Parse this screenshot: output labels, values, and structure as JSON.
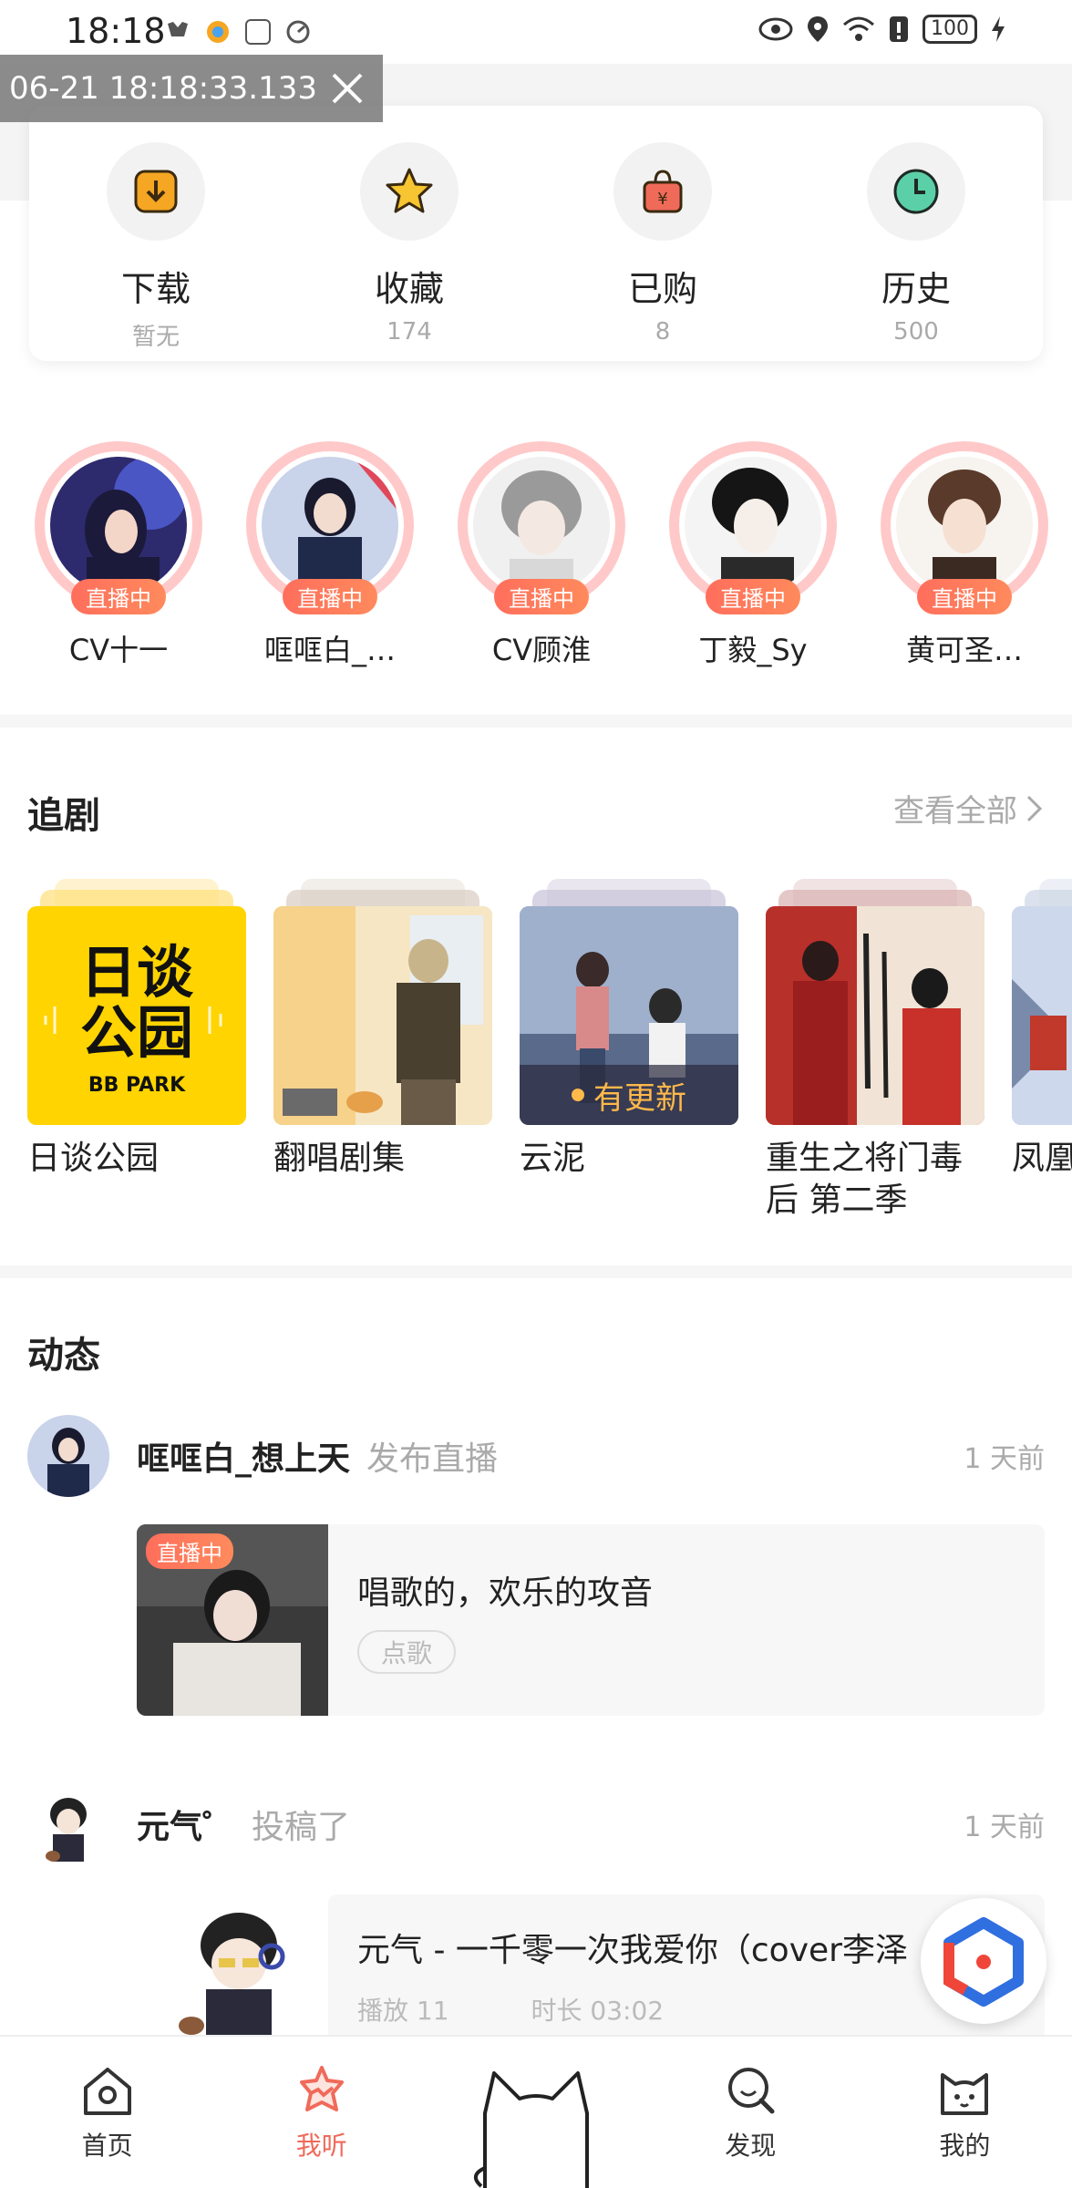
{
  "status_bar": {
    "time": "18:18",
    "battery": "100"
  },
  "toast": {
    "text": "06-21 18:18:33.133"
  },
  "quick_actions": [
    {
      "label": "下载",
      "sub": "暂无",
      "icon": "download-icon",
      "color": "#f5a623"
    },
    {
      "label": "收藏",
      "sub": "174",
      "icon": "star-icon",
      "color": "#f7c531"
    },
    {
      "label": "已购",
      "sub": "8",
      "icon": "shopping-bag-icon",
      "color": "#f06a5a"
    },
    {
      "label": "历史",
      "sub": "500",
      "icon": "clock-icon",
      "color": "#5bd0a8"
    }
  ],
  "live_users": [
    {
      "name": "CV十一",
      "badge": "直播中"
    },
    {
      "name": "哐哐白_…",
      "badge": "直播中"
    },
    {
      "name": "CV顾淮",
      "badge": "直播中"
    },
    {
      "name": "丁毅_Sy",
      "badge": "直播中"
    },
    {
      "name": "黄可圣…",
      "badge": "直播中"
    }
  ],
  "drama_section": {
    "title": "追剧",
    "view_all": "查看全部",
    "items": [
      {
        "title": "日谈公园",
        "cover_text_line1": "日谈",
        "cover_text_line2": "公园",
        "cover_text_line3": "BB PARK"
      },
      {
        "title": "翻唱剧集"
      },
      {
        "title": "云泥",
        "update": "有更新"
      },
      {
        "title": "重生之将门毒后 第二季"
      },
      {
        "title": "凤凰"
      }
    ]
  },
  "feed_section": {
    "title": "动态",
    "posts": [
      {
        "user": "哐哐白_想上天",
        "action": "发布直播",
        "time": "1 天前",
        "badge": "直播中",
        "card_title": "唱歌的，欢乐的攻音",
        "tag": "点歌"
      },
      {
        "user": "元气゜",
        "action": "投稿了",
        "time": "1 天前",
        "card_title": "元气 - 一千零一次我爱你（cover李泽",
        "plays": "播放 11",
        "duration": "时长 03:02"
      }
    ]
  },
  "bottom_nav": [
    {
      "label": "首页",
      "icon": "home-icon"
    },
    {
      "label": "我听",
      "icon": "listen-icon",
      "active": true
    },
    {
      "label": "",
      "icon": "cat-center-icon"
    },
    {
      "label": "发现",
      "icon": "discover-icon"
    },
    {
      "label": "我的",
      "icon": "profile-cat-icon"
    }
  ],
  "colors": {
    "accent": "#f06a5a",
    "live_ring": "#ffc9c9",
    "update": "#ffb84a"
  }
}
